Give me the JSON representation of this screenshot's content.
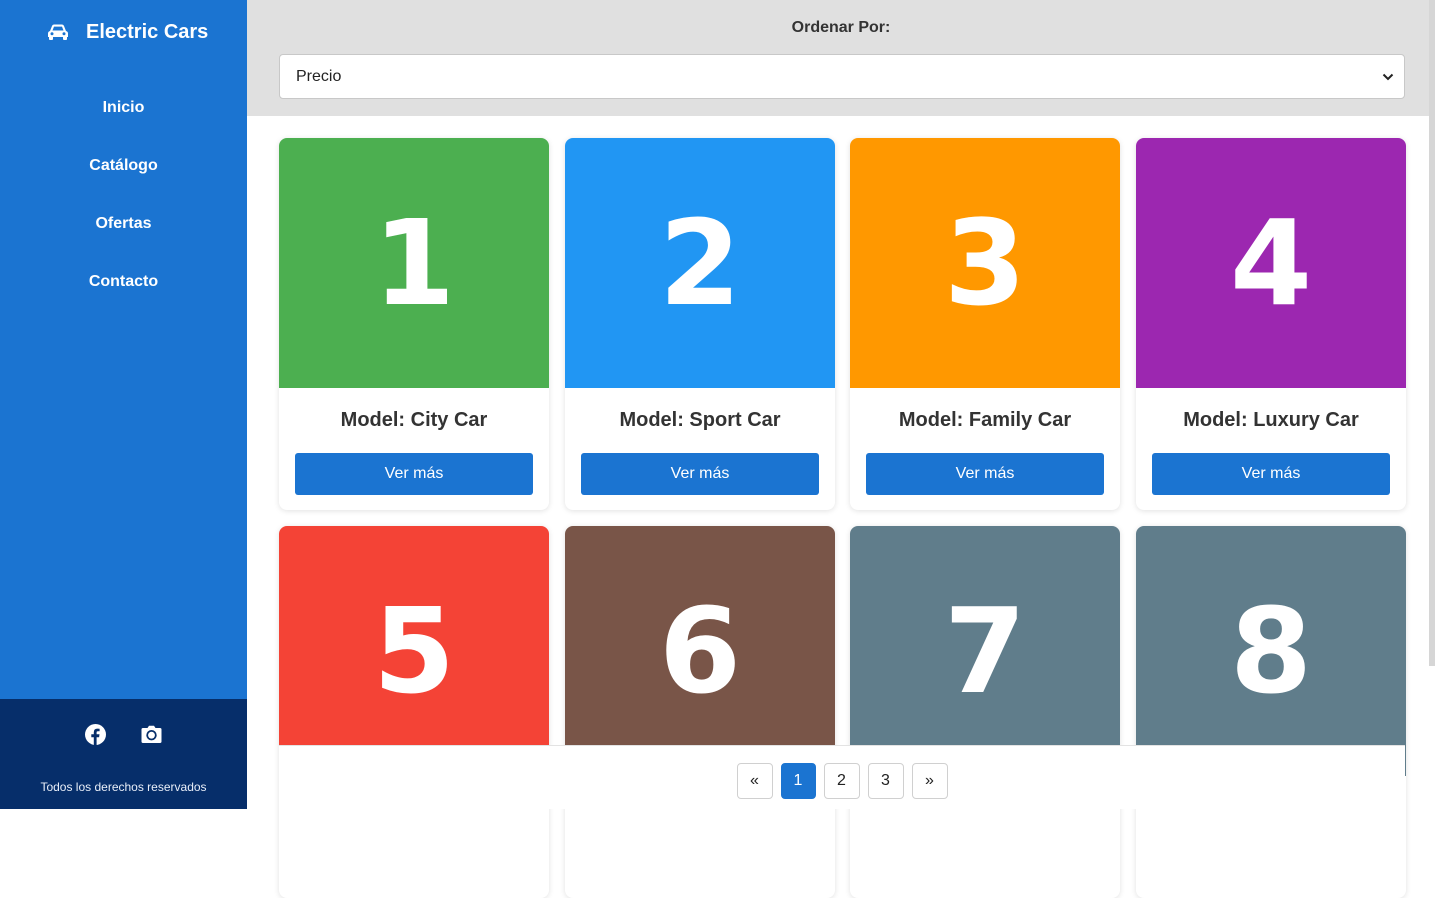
{
  "brand": {
    "title": "Electric Cars",
    "icon": "car-icon"
  },
  "nav": {
    "items": [
      {
        "label": "Inicio"
      },
      {
        "label": "Catálogo"
      },
      {
        "label": "Ofertas"
      },
      {
        "label": "Contacto"
      }
    ]
  },
  "footer": {
    "socials": [
      "facebook-icon",
      "camera-icon"
    ],
    "copyright": "Todos los derechos reservados"
  },
  "sort": {
    "label": "Ordenar Por:",
    "selected": "Precio"
  },
  "cards": [
    {
      "number": "1",
      "model": "Model: City Car",
      "button": "Ver más",
      "color": "#4caf50"
    },
    {
      "number": "2",
      "model": "Model: Sport Car",
      "button": "Ver más",
      "color": "#2196f3"
    },
    {
      "number": "3",
      "model": "Model: Family Car",
      "button": "Ver más",
      "color": "#ff9800"
    },
    {
      "number": "4",
      "model": "Model: Luxury Car",
      "button": "Ver más",
      "color": "#9c27b0"
    },
    {
      "number": "5",
      "color": "#f44336"
    },
    {
      "number": "6",
      "color": "#795548"
    },
    {
      "number": "7",
      "color": "#607d8b"
    },
    {
      "number": "8",
      "color": "#607d8b"
    }
  ],
  "pagination": {
    "prev": "«",
    "pages": [
      "1",
      "2",
      "3"
    ],
    "current": "1",
    "next": "»"
  }
}
